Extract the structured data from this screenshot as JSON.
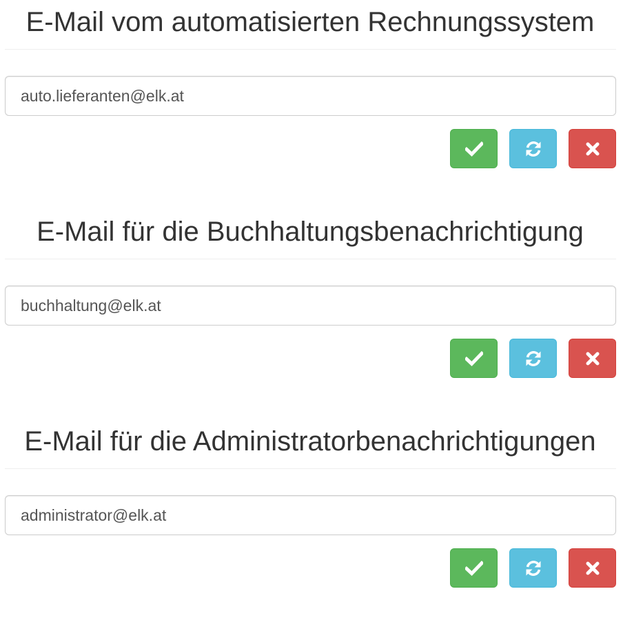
{
  "colors": {
    "success": "#5cb85c",
    "info": "#5bc0de",
    "danger": "#d9534f",
    "text": "#333333",
    "input_border": "#cccccc"
  },
  "icons": {
    "save": "check-icon",
    "reset": "refresh-icon",
    "delete": "times-icon"
  },
  "sections": [
    {
      "title": "E-Mail vom automatisierten Rechnungssystem",
      "email": "auto.lieferanten@elk.at"
    },
    {
      "title": "E-Mail für die Buchhaltungsbenachrichtigung",
      "email": "buchhaltung@elk.at"
    },
    {
      "title": "E-Mail für die Administratorbenachrichtigungen",
      "email": "administrator@elk.at"
    }
  ]
}
